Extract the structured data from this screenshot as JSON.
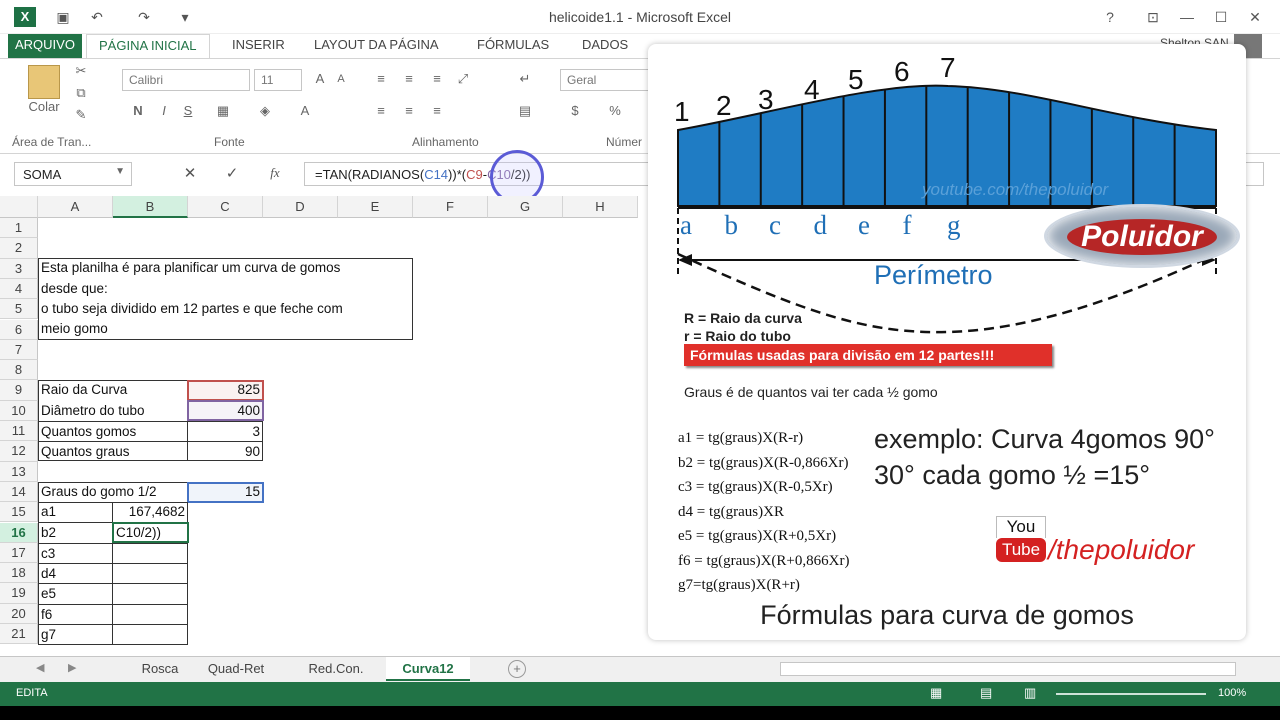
{
  "window": {
    "app_icon": "X",
    "title": "helicoide1.1 - Microsoft Excel",
    "help": "?",
    "ribbon_display": "⊡",
    "minimize": "—",
    "maximize": "☐",
    "close": "✕"
  },
  "ribbon": {
    "tabs": [
      "ARQUIVO",
      "PÁGINA INICIAL",
      "INSERIR",
      "LAYOUT DA PÁGINA",
      "FÓRMULAS",
      "DADOS"
    ],
    "user": "Shelton SAN",
    "paste_label": "Colar",
    "groups": [
      "Área de Tran...",
      "Fonte",
      "Alinhamento",
      "Númer"
    ],
    "font_name": "Calibri",
    "font_size": "11",
    "number_format": "Geral",
    "bold": "N",
    "italic": "I",
    "underline": "S",
    "percent": "%"
  },
  "formula_bar": {
    "name_box": "SOMA",
    "fx": "fx",
    "parts": [
      {
        "text": "=TAN(RADIANOS(",
        "color": "#222222"
      },
      {
        "text": "C14",
        "color": "#4472c4"
      },
      {
        "text": "))*(",
        "color": "#222222"
      },
      {
        "text": "C9",
        "color": "#c0504d"
      },
      {
        "text": "-",
        "color": "#222222"
      },
      {
        "text": "C10",
        "color": "#8064a2"
      },
      {
        "text": "/2))",
        "color": "#222222"
      }
    ]
  },
  "grid": {
    "columns": [
      "A",
      "B",
      "C",
      "D",
      "E",
      "F",
      "G",
      "H"
    ],
    "rows": [
      "1",
      "2",
      "3",
      "4",
      "5",
      "6",
      "7",
      "8",
      "9",
      "10",
      "11",
      "12",
      "13",
      "14",
      "15",
      "16",
      "17",
      "18",
      "19",
      "20",
      "21"
    ],
    "note": [
      "Esta planilha é para planificar um curva de gomos",
      "desde que:",
      "o tubo seja dividido em 12 partes e que feche com",
      "meio gomo"
    ],
    "params": [
      {
        "label": "Raio da Curva",
        "value": "825"
      },
      {
        "label": "Diâmetro do tubo",
        "value": "400"
      },
      {
        "label": "Quantos gomos",
        "value": "3"
      },
      {
        "label": "Quantos graus",
        "value": "90"
      }
    ],
    "graus_label": "Graus do gomo 1/2",
    "graus_value": "15",
    "results": [
      {
        "label": "a1",
        "value": "167,4682"
      },
      {
        "label": "b2",
        "value": "C10/2))"
      },
      {
        "label": "c3",
        "value": ""
      },
      {
        "label": "d4",
        "value": ""
      },
      {
        "label": "e5",
        "value": ""
      },
      {
        "label": "f6",
        "value": ""
      },
      {
        "label": "g7",
        "value": ""
      }
    ]
  },
  "sheet_tabs": [
    "Rosca",
    "Quad-Ret",
    "Red.Con.",
    "Curva12"
  ],
  "active_sheet": "Curva12",
  "status": {
    "mode": "EDITA",
    "zoom": "100%"
  },
  "panel": {
    "top_numbers": [
      "1",
      "2",
      "3",
      "4",
      "5",
      "6",
      "7"
    ],
    "letters": [
      "a",
      "b",
      "c",
      "d",
      "e",
      "f",
      "g"
    ],
    "watermark": "youtube.com/thepoluidor",
    "logo": "Poluidor",
    "perimetro": "Perímetro",
    "legend_R": "R = Raio da curva",
    "legend_r": "r = Raio do tubo",
    "banner": "Fórmulas usadas para divisão em 12 partes!!!",
    "graus_note": "Graus é de quantos vai ter cada ½ gomo",
    "formulas": [
      "a1 = tg(graus)X(R-r)",
      "b2 = tg(graus)X(R-0,866Xr)",
      "c3 = tg(graus)X(R-0,5Xr)",
      "d4 = tg(graus)XR",
      "e5 = tg(graus)X(R+0,5Xr)",
      "f6 = tg(graus)X(R+0,866Xr)",
      "g7=tg(graus)X(R+r)"
    ],
    "example_1": "exemplo: Curva 4gomos 90°",
    "example_2": "30° cada gomo ½ =15°",
    "yt_you": "You",
    "yt_tube": "Tube",
    "yt_handle": "/thepoluidor",
    "footer": "Fórmulas para curva de gomos"
  },
  "colors": {
    "excel_green": "#217346",
    "shape_blue": "#1f7cc4",
    "banner_red": "#e0302a",
    "perimetro_blue": "#1f6fb6"
  }
}
